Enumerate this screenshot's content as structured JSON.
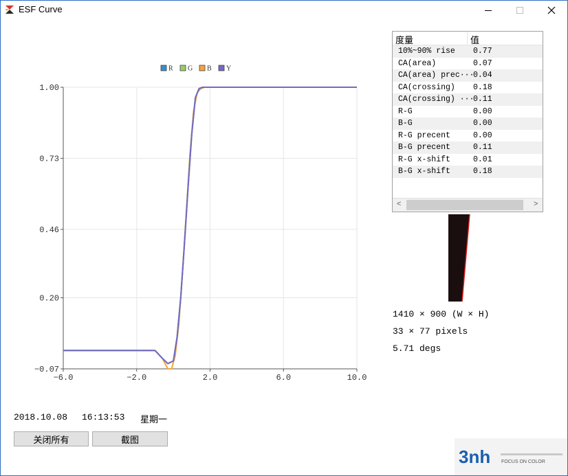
{
  "window": {
    "title": "ESF Curve",
    "controls": {
      "minimize": "—",
      "maximize": "☐",
      "close": "✕"
    }
  },
  "chart_data": {
    "type": "line",
    "legend": [
      "R",
      "G",
      "B",
      "Y"
    ],
    "legend_placement": "top-center",
    "x_ticks": [
      "-6.0",
      "-2.0",
      "2.0",
      "6.0",
      "10.0"
    ],
    "y_ticks": [
      "1.00",
      "0.73",
      "0.46",
      "0.20",
      "-0.07"
    ],
    "xlim": [
      -6.0,
      10.0
    ],
    "ylim": [
      -0.07,
      1.0
    ],
    "grid": true,
    "colors": {
      "R": "#3a8fc7",
      "G": "#9acb6b",
      "B": "#f5a33c",
      "Y": "#7468c4"
    },
    "series": [
      {
        "name": "R",
        "x": [
          -6.0,
          -2.0,
          -1.0,
          -0.6,
          -0.3,
          0.0,
          0.2,
          0.4,
          0.6,
          0.8,
          1.0,
          1.2,
          1.4,
          1.6,
          2.0,
          10.0
        ],
        "y": [
          0.0,
          0.0,
          0.0,
          -0.03,
          -0.05,
          -0.04,
          0.05,
          0.2,
          0.4,
          0.62,
          0.82,
          0.96,
          0.995,
          1.0,
          1.0,
          1.0
        ]
      },
      {
        "name": "G",
        "x": [
          -6.0,
          -2.0,
          -1.0,
          -0.6,
          -0.3,
          0.0,
          0.2,
          0.4,
          0.6,
          0.8,
          1.0,
          1.2,
          1.4,
          1.6,
          2.0,
          10.0
        ],
        "y": [
          0.0,
          0.0,
          0.0,
          -0.03,
          -0.05,
          -0.04,
          0.05,
          0.2,
          0.4,
          0.62,
          0.82,
          0.96,
          0.995,
          1.0,
          1.0,
          1.0
        ]
      },
      {
        "name": "B",
        "x": [
          -6.0,
          -2.0,
          -1.0,
          -0.6,
          -0.3,
          -0.1,
          0.1,
          0.3,
          0.5,
          0.7,
          0.9,
          1.1,
          1.3,
          1.5,
          1.7,
          2.0,
          10.0
        ],
        "y": [
          0.0,
          0.0,
          0.0,
          -0.03,
          -0.07,
          -0.07,
          -0.02,
          0.1,
          0.3,
          0.52,
          0.74,
          0.91,
          0.98,
          0.995,
          1.0,
          1.0,
          1.0
        ]
      },
      {
        "name": "Y",
        "x": [
          -6.0,
          -2.0,
          -1.0,
          -0.6,
          -0.3,
          0.0,
          0.2,
          0.4,
          0.6,
          0.8,
          1.0,
          1.2,
          1.4,
          1.6,
          2.0,
          10.0
        ],
        "y": [
          0.0,
          0.0,
          0.0,
          -0.03,
          -0.05,
          -0.04,
          0.05,
          0.2,
          0.4,
          0.62,
          0.82,
          0.96,
          0.995,
          1.0,
          1.0,
          1.0
        ]
      }
    ]
  },
  "metrics": {
    "headers": [
      "度量",
      "值"
    ],
    "rows": [
      {
        "name": "10%~90% rise",
        "value": "0.77"
      },
      {
        "name": "CA(area)",
        "value": "0.07"
      },
      {
        "name": "CA(area) prec···",
        "value": "0.04"
      },
      {
        "name": "CA(crossing)",
        "value": "0.18"
      },
      {
        "name": "CA(crossing) ···",
        "value": "0.11"
      },
      {
        "name": "R-G",
        "value": "0.00"
      },
      {
        "name": "B-G",
        "value": "0.00"
      },
      {
        "name": "R-G precent",
        "value": "0.00"
      },
      {
        "name": "B-G precent",
        "value": "0.11"
      },
      {
        "name": "R-G x-shift",
        "value": "0.01"
      },
      {
        "name": "B-G x-shift",
        "value": "0.18"
      }
    ],
    "scroll_left": "<",
    "scroll_right": ">"
  },
  "info": {
    "resolution": "1410 × 900 (W × H)",
    "roi": "33 × 77 pixels",
    "angle": "5.71 degs"
  },
  "status": {
    "date": "2018.10.08",
    "time": "16:13:53",
    "weekday": "星期一"
  },
  "buttons": {
    "close_all": "关闭所有",
    "screenshot": "截图"
  },
  "logo": {
    "brand": "3nh",
    "tagline": "FOCUS ON COLOR"
  }
}
